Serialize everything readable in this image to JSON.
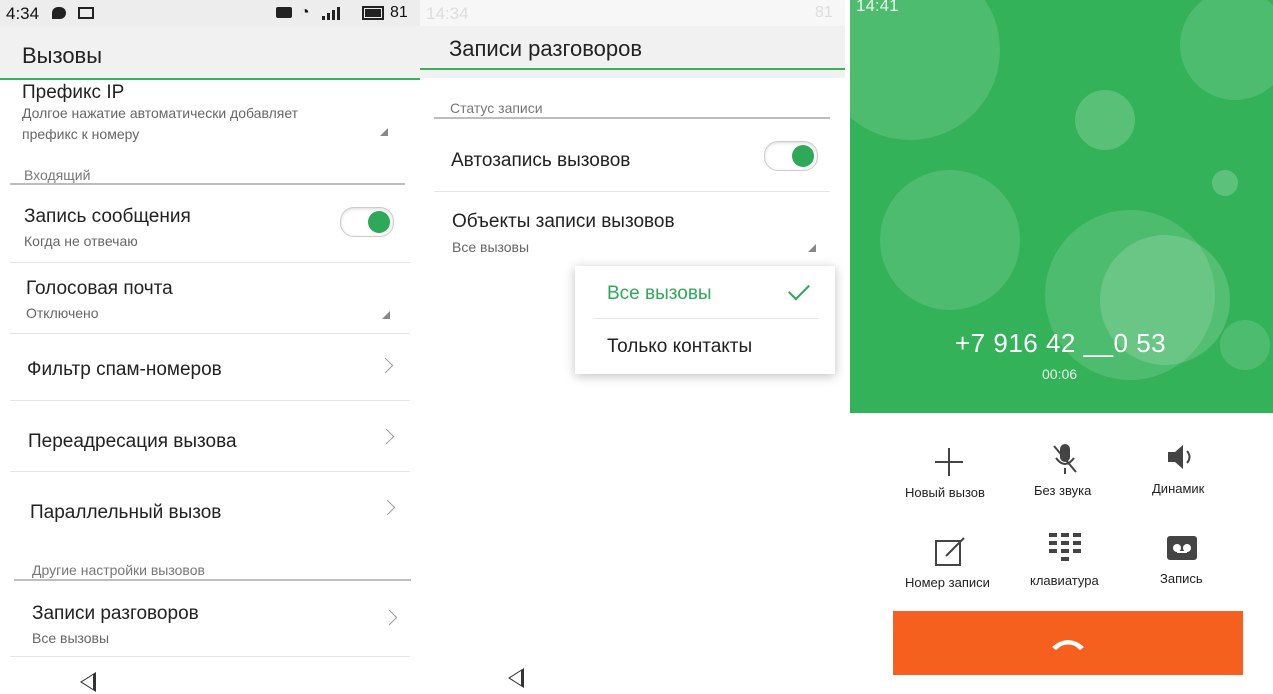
{
  "panel1": {
    "status": {
      "time": "4:34",
      "battery": "81"
    },
    "title": "Вызовы",
    "ip_prefix": {
      "title": "Префикс IP",
      "sub1": "Долгое нажатие автоматически добавляет",
      "sub2": "префикс к номеру"
    },
    "section_incoming": "Входящий",
    "record_message": {
      "title": "Запись сообщения",
      "sub": "Когда не отвечаю",
      "toggle_on": true
    },
    "voicemail": {
      "title": "Голосовая почта",
      "sub": "Отключено"
    },
    "spam_filter": "Фильтр спам-номеров",
    "call_forwarding": "Переадресация вызова",
    "parallel_call": "Параллельный вызов",
    "section_other": "Другие настройки вызовов",
    "call_records": {
      "title": "Записи разговоров",
      "sub": "Все вызовы"
    }
  },
  "panel2": {
    "status": {
      "time": "14:34",
      "battery": "81"
    },
    "title": "Записи разговоров",
    "section_status": "Статус записи",
    "auto_record": {
      "title": "Автозапись вызовов",
      "toggle_on": true
    },
    "record_targets": {
      "title": "Объекты записи вызовов",
      "sub": "Все вызовы"
    },
    "popup": {
      "options": [
        "Все вызовы",
        "Только контакты"
      ],
      "selected": "Все вызовы"
    }
  },
  "panel3": {
    "status": {
      "time": "14:41"
    },
    "phone_number": "+7 916 42 __0 53",
    "duration": "00:06",
    "buttons": [
      {
        "label": "Новый вызов",
        "icon": "plus-icon"
      },
      {
        "label": "Без звука",
        "icon": "mic-off-icon"
      },
      {
        "label": "Динамик",
        "icon": "speaker-icon"
      },
      {
        "label": "Номер записи",
        "icon": "note-icon"
      },
      {
        "label": "клавиатура",
        "icon": "keypad-icon"
      },
      {
        "label": "Запись",
        "icon": "record-icon"
      }
    ],
    "hangup_icon": "phone-hangup-icon"
  },
  "colors": {
    "accent_green": "#34b259",
    "hangup_orange": "#f6601f"
  }
}
